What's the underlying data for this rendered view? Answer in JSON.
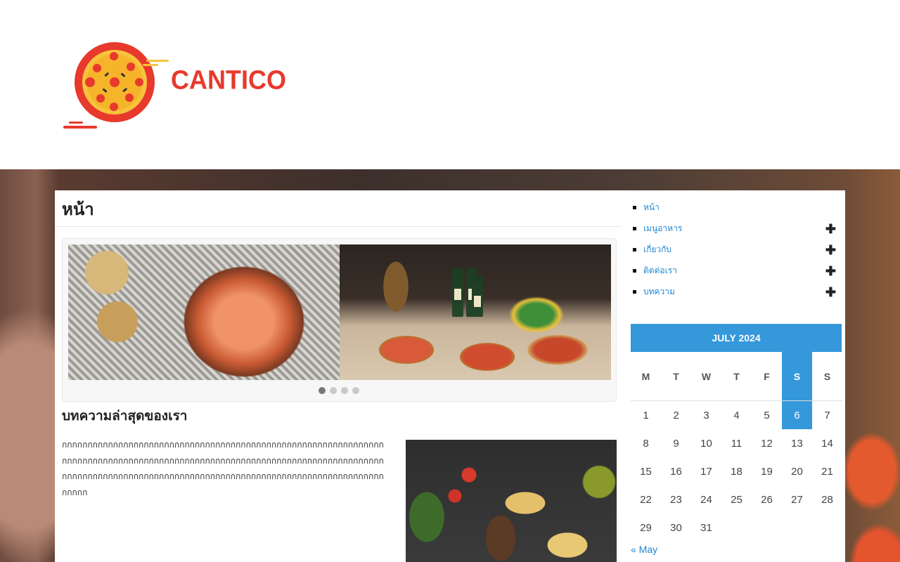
{
  "brand": {
    "name": "CANTICO",
    "accent": "#e8392d"
  },
  "page": {
    "title": "หน้า"
  },
  "slider": {
    "slides": [
      "seafood-platter",
      "pizza-table"
    ],
    "dots": 4,
    "active_index": 0
  },
  "section": {
    "title": "บทความล่าสุดของเรา",
    "body": "กกกกกกกกกกกกกกกกกกกกกกกกกกกกกกกกกกกกกกกกกกกกกกกกกกกกกกกกกกกกกกกกกกกกกกกกกกกกกกกกกกกกกกกกกกกกกกกกกกกกกกกกกกกกกกกกกกกกกกกกกกกกกกกกกกกกกกกกกกกกกกกกกกกกกกกกกกกกกกกกกกกกกกกกกกกกกกกกกกกกกกกกกกกกกกกกกก"
  },
  "sidebar": {
    "menu": [
      {
        "label": "หน้า",
        "has_children": false
      },
      {
        "label": "เมนูอาหาร",
        "has_children": true
      },
      {
        "label": "เกี่ยวกับ",
        "has_children": true
      },
      {
        "label": "ติดต่อเรา",
        "has_children": true
      },
      {
        "label": "บทความ",
        "has_children": true
      }
    ],
    "calendar": {
      "title": "JULY 2024",
      "weekdays": [
        "M",
        "T",
        "W",
        "T",
        "F",
        "S",
        "S"
      ],
      "highlight_weekday_index": 5,
      "today": 6,
      "start_offset": 0,
      "days_in_month": 31,
      "prev_link": "« May",
      "accent": "#3498db"
    }
  }
}
